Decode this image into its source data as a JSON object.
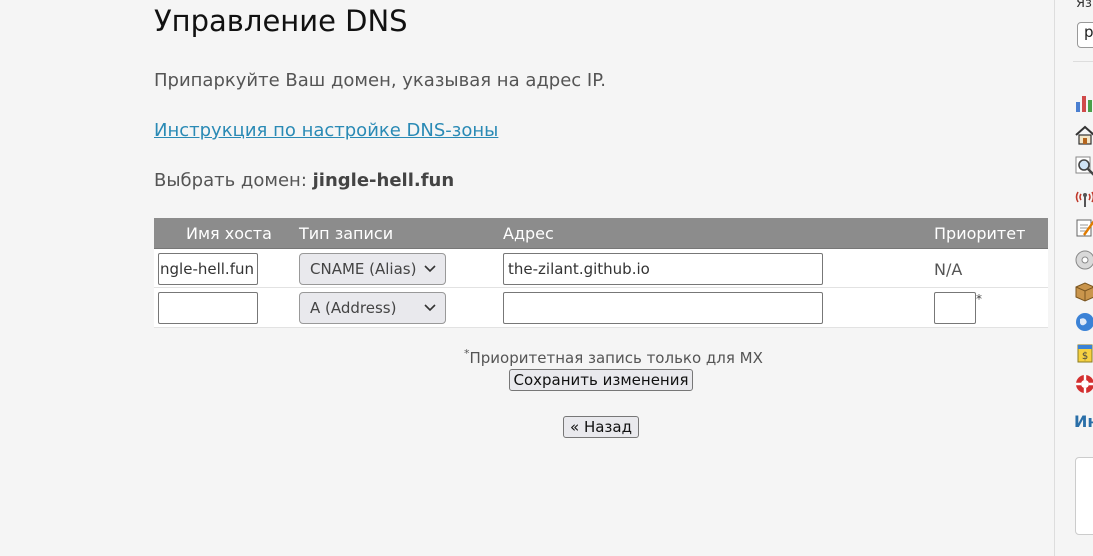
{
  "page": {
    "title": "Управление DNS",
    "lead": "Припаркуйте Ваш домен, указывая на адрес IP.",
    "help_link": "Инструкция по настройке DNS-зоны",
    "domain_label": "Выбрать домен:",
    "domain_value": "jingle-hell.fun"
  },
  "table": {
    "headers": [
      "Имя хоста",
      "Тип записи",
      "Адрес",
      "Приоритет"
    ],
    "rows": [
      {
        "host": "ngle-hell.fun",
        "type": "CNAME (Alias)",
        "address": "the-zilant.github.io",
        "priority": "N/A"
      },
      {
        "host": "",
        "type": "A (Address)",
        "address": "",
        "priority": "",
        "priority_marker": "*"
      }
    ]
  },
  "mx_note": {
    "marker": "*",
    "text": "Приоритетная запись только для MX"
  },
  "buttons": {
    "save": "Сохранить изменения",
    "back": "« Назад"
  },
  "sidebar": {
    "lang_label": "Яз",
    "lang_select": "р",
    "icons": [
      "bar-chart-icon",
      "home-icon",
      "magnifier-icon",
      "antenna-icon",
      "notepad-icon",
      "disc-icon",
      "package-icon",
      "globe-icon",
      "billing-icon",
      "lifebuoy-icon"
    ],
    "heading": "Ин"
  },
  "colors": {
    "table_header_bg": "#8c8c8c",
    "link": "#2a8ab5",
    "sidebar_heading": "#2a6fa8"
  }
}
